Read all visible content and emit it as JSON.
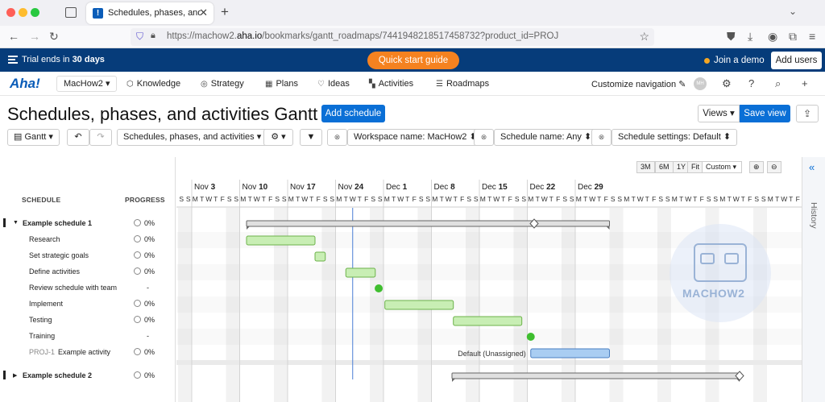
{
  "browser": {
    "tab_title": "Schedules, phases, and activities",
    "tab_favicon": "!",
    "url_prefix": "https://machow2.",
    "url_domain": "aha.io",
    "url_path": "/bookmarks/gantt_roadmaps/7441948218517458732?product_id=PROJ"
  },
  "trial": {
    "text_prefix": "Trial ends in ",
    "text_bold": "30 days",
    "quick_start": "Quick start guide",
    "join_demo": "Join a demo",
    "add_users": "Add users"
  },
  "nav": {
    "logo": "Aha!",
    "workspace": "MacHow2 ▾",
    "items": [
      {
        "label": "Knowledge",
        "icon": "knowledge-icon",
        "glyph": "⬡"
      },
      {
        "label": "Strategy",
        "icon": "strategy-icon",
        "glyph": "◎"
      },
      {
        "label": "Plans",
        "icon": "plans-icon",
        "glyph": "▦"
      },
      {
        "label": "Ideas",
        "icon": "ideas-icon",
        "glyph": "♡"
      },
      {
        "label": "Activities",
        "icon": "activities-icon",
        "glyph": "▚"
      },
      {
        "label": "Roadmaps",
        "icon": "roadmaps-icon",
        "glyph": "☰"
      }
    ],
    "customize": "Customize navigation ✎",
    "avatar": "MH"
  },
  "page": {
    "title": "Schedules, phases, and activities Gantt",
    "add_schedule": "Add schedule",
    "views": "Views ▾",
    "save_view": "Save view"
  },
  "filters": {
    "gantt": "Gantt ▾",
    "view_type": "Schedules, phases, and activities ▾",
    "settings": "⚙ ▾",
    "workspace": "Workspace name: MacHow2 ⬍",
    "schedule_name": "Schedule name: Any ⬍",
    "schedule_settings": "Schedule settings: Default ⬍"
  },
  "gantt": {
    "col_schedule": "SCHEDULE",
    "col_progress": "PROGRESS",
    "zoom": {
      "b3m": "3M",
      "b6m": "6M",
      "b1y": "1Y",
      "fit": "Fit",
      "custom": "Custom ▾"
    },
    "weeks": [
      "Nov 3",
      "Nov 10",
      "Nov 17",
      "Nov 24",
      "Dec 1",
      "Dec 8",
      "Dec 15",
      "Dec 22",
      "Dec 29"
    ],
    "day_letters": [
      "S",
      "S",
      "M",
      "T",
      "W",
      "T",
      "F"
    ],
    "rows": [
      {
        "label": "Example schedule 1",
        "progress": "0%",
        "type": "schedule"
      },
      {
        "label": "Research",
        "progress": "0%",
        "type": "activity"
      },
      {
        "label": "Set strategic goals",
        "progress": "0%",
        "type": "activity"
      },
      {
        "label": "Define activities",
        "progress": "0%",
        "type": "activity"
      },
      {
        "label": "Review schedule with team",
        "progress": "-",
        "type": "milestone"
      },
      {
        "label": "Implement",
        "progress": "0%",
        "type": "activity"
      },
      {
        "label": "Testing",
        "progress": "0%",
        "type": "activity"
      },
      {
        "label": "Training",
        "progress": "-",
        "type": "milestone"
      },
      {
        "label": "Example activity",
        "id": "PROJ-1",
        "progress": "0%",
        "type": "activity",
        "bar_label": "Default (Unassigned)"
      },
      {
        "label": "Example schedule 2",
        "progress": "0%",
        "type": "schedule"
      }
    ],
    "history": "History",
    "watermark": "MACHOW2"
  },
  "colors": {
    "brand_blue": "#0a6fd6",
    "trial_bar": "#063c7a",
    "orange": "#f58220",
    "bar_green": "#c8eeb4",
    "milestone_green": "#3fbe2f",
    "bar_blue": "#a9cdf2",
    "today_line": "#4a7fd6"
  }
}
